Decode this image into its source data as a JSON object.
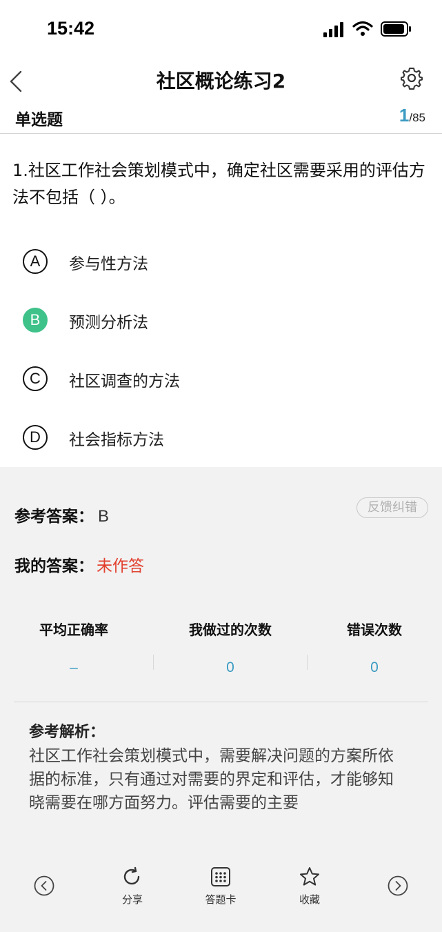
{
  "status_bar": {
    "time": "15:42"
  },
  "nav": {
    "title": "社区概论练习2"
  },
  "question_header": {
    "type_label": "单选题",
    "current": "1",
    "total": "/85"
  },
  "question": {
    "text": "1.社区工作社会策划模式中，确定社区需要采用的评估方法不包括（ ）。"
  },
  "options": [
    {
      "letter": "A",
      "text": "参与性方法",
      "selected": false
    },
    {
      "letter": "B",
      "text": "预测分析法",
      "selected": true
    },
    {
      "letter": "C",
      "text": "社区调查的方法",
      "selected": false
    },
    {
      "letter": "D",
      "text": "社会指标方法",
      "selected": false
    }
  ],
  "answer": {
    "ref_label": "参考答案：",
    "ref_value": "B",
    "my_label": "我的答案：",
    "my_value": "未作答",
    "feedback_label": "反馈纠错"
  },
  "stats": [
    {
      "label": "平均正确率",
      "value": "–"
    },
    {
      "label": "我做过的次数",
      "value": "0"
    },
    {
      "label": "错误次数",
      "value": "0"
    }
  ],
  "explanation": {
    "title": "参考解析：",
    "body": "社区工作社会策划模式中，需要解决问题的方案所依据的标准，只有通过对需要的界定和评估，才能够知晓需要在哪方面努力。评估需要的主要"
  },
  "bottom_bar": {
    "share_label": "分享",
    "card_label": "答题卡",
    "favorite_label": "收藏"
  },
  "colors": {
    "accent": "#3a9bc2",
    "selected": "#3fc28a",
    "error": "#e2402f"
  }
}
